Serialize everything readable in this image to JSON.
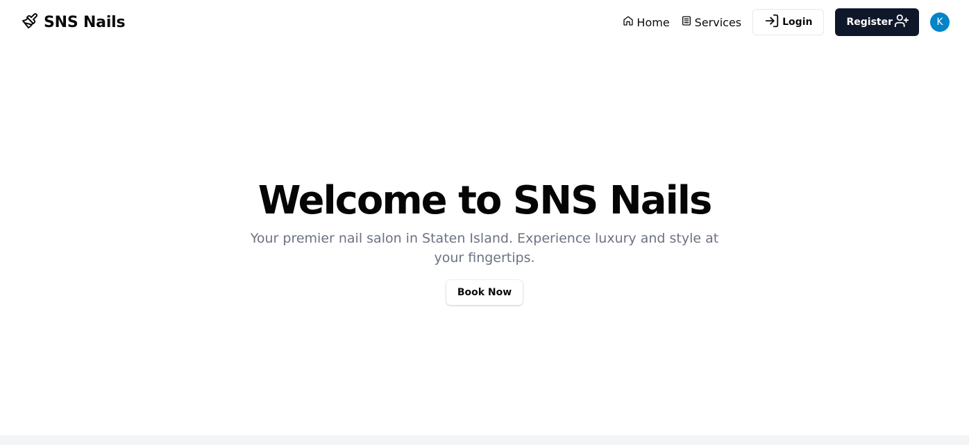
{
  "header": {
    "brand_name": "SNS Nails",
    "brand_icon": "paintbrush-icon",
    "nav": {
      "home_label": "Home",
      "services_label": "Services",
      "login_label": "Login",
      "register_label": "Register",
      "avatar_initial": "K"
    }
  },
  "hero": {
    "title": "Welcome to SNS Nails",
    "subtitle": "Your premier nail salon in Staten Island. Experience luxury and style at your fingertips.",
    "cta_label": "Book Now"
  },
  "colors": {
    "register_bg": "#0f172a",
    "avatar_bg": "#0284c7",
    "subtitle_text": "#6b7280",
    "footer_strip": "#f3f4f6"
  }
}
